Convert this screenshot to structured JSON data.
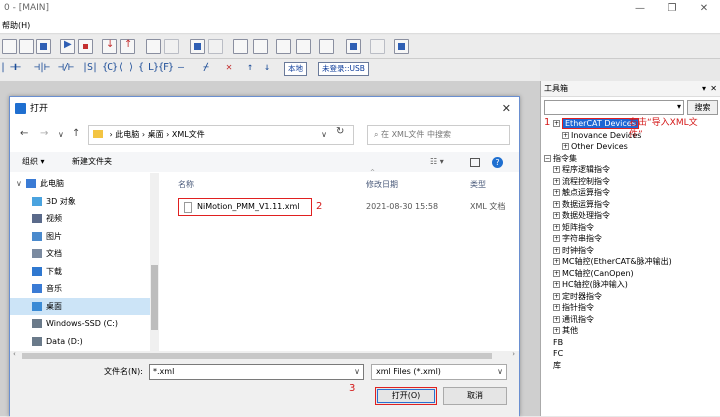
{
  "app": {
    "title_fragment": "0 - [MAIN]",
    "menu_help": "帮助(H)",
    "toolbar_local": "本地",
    "toolbar_login": "未登录::USB",
    "ladder_glyphs": [
      "|  ⊣⊢",
      "⊣|⊢",
      "⊣/⊢",
      "|S| {C}",
      "⟨ ⟩",
      "{ L}",
      "{F}",
      "—",
      "⌿",
      "✕",
      "↑",
      "↓"
    ]
  },
  "toolbox": {
    "title": "工具箱",
    "pin": "▾",
    "close": "✕",
    "search_button": "搜索",
    "tree": [
      {
        "label": "EtherCAT Devices",
        "depth": 1,
        "selected": true
      },
      {
        "label": "Inovance Devices",
        "depth": 2
      },
      {
        "label": "Other Devices",
        "depth": 2
      },
      {
        "label": "指令集",
        "depth": 0
      },
      {
        "label": "程序逻辑指令",
        "depth": 1
      },
      {
        "label": "流程控制指令",
        "depth": 1
      },
      {
        "label": "触点运算指令",
        "depth": 1
      },
      {
        "label": "数据运算指令",
        "depth": 1
      },
      {
        "label": "数据处理指令",
        "depth": 1
      },
      {
        "label": "矩阵指令",
        "depth": 1
      },
      {
        "label": "字符串指令",
        "depth": 1
      },
      {
        "label": "时钟指令",
        "depth": 1
      },
      {
        "label": "MC轴控(EtherCAT&脉冲输出)",
        "depth": 1
      },
      {
        "label": "MC轴控(CanOpen)",
        "depth": 1
      },
      {
        "label": "HC轴控(脉冲输入)",
        "depth": 1
      },
      {
        "label": "定时器指令",
        "depth": 1
      },
      {
        "label": "指针指令",
        "depth": 1
      },
      {
        "label": "通讯指令",
        "depth": 1
      },
      {
        "label": "其他",
        "depth": 1
      },
      {
        "label": "FB",
        "depth": 0
      },
      {
        "label": "FC",
        "depth": 0
      },
      {
        "label": "库",
        "depth": 0
      }
    ],
    "annot_num": "1",
    "annot_text_1": "右击“导入XML文",
    "annot_text_2": "件”"
  },
  "dialog": {
    "title": "打开",
    "close": "✕",
    "breadcrumb": [
      "此电脑",
      "桌面",
      "XML文件"
    ],
    "search_placeholder": "在 XML文件 中搜索",
    "organize": "组织 ▾",
    "new_folder": "新建文件夹",
    "nav": [
      {
        "label": "此电脑",
        "icon": "pc-icon",
        "color": "#3a7bd5",
        "indent": 0
      },
      {
        "label": "3D 对象",
        "icon": "3d-objects-icon",
        "color": "#4aa3df",
        "indent": 1
      },
      {
        "label": "视频",
        "icon": "video-icon",
        "color": "#5a6a8a",
        "indent": 1
      },
      {
        "label": "图片",
        "icon": "pictures-icon",
        "color": "#4a8acd",
        "indent": 1
      },
      {
        "label": "文档",
        "icon": "documents-icon",
        "color": "#7a8aa0",
        "indent": 1
      },
      {
        "label": "下载",
        "icon": "downloads-icon",
        "color": "#2f78d0",
        "indent": 1
      },
      {
        "label": "音乐",
        "icon": "music-icon",
        "color": "#3a7bd5",
        "indent": 1
      },
      {
        "label": "桌面",
        "icon": "desktop-icon",
        "color": "#3a8ad5",
        "indent": 1,
        "selected": true
      },
      {
        "label": "Windows-SSD (C:)",
        "icon": "drive-c-icon",
        "color": "#6a7a8a",
        "indent": 1
      },
      {
        "label": "Data (D:)",
        "icon": "drive-d-icon",
        "color": "#6a7a8a",
        "indent": 1
      }
    ],
    "columns": {
      "name": "名称",
      "date": "修改日期",
      "type": "类型"
    },
    "files": [
      {
        "name": "NiMotion_PMM_V1.11.xml",
        "date": "2021-08-30  15:58",
        "type": "XML 文档"
      }
    ],
    "annot_file": "2",
    "filename_label": "文件名(N):",
    "filename_value": "*.xml",
    "filetype_value": "xml Files (*.xml)",
    "open_button": "打开(O)",
    "cancel_button": "取消",
    "annot_open": "3"
  }
}
